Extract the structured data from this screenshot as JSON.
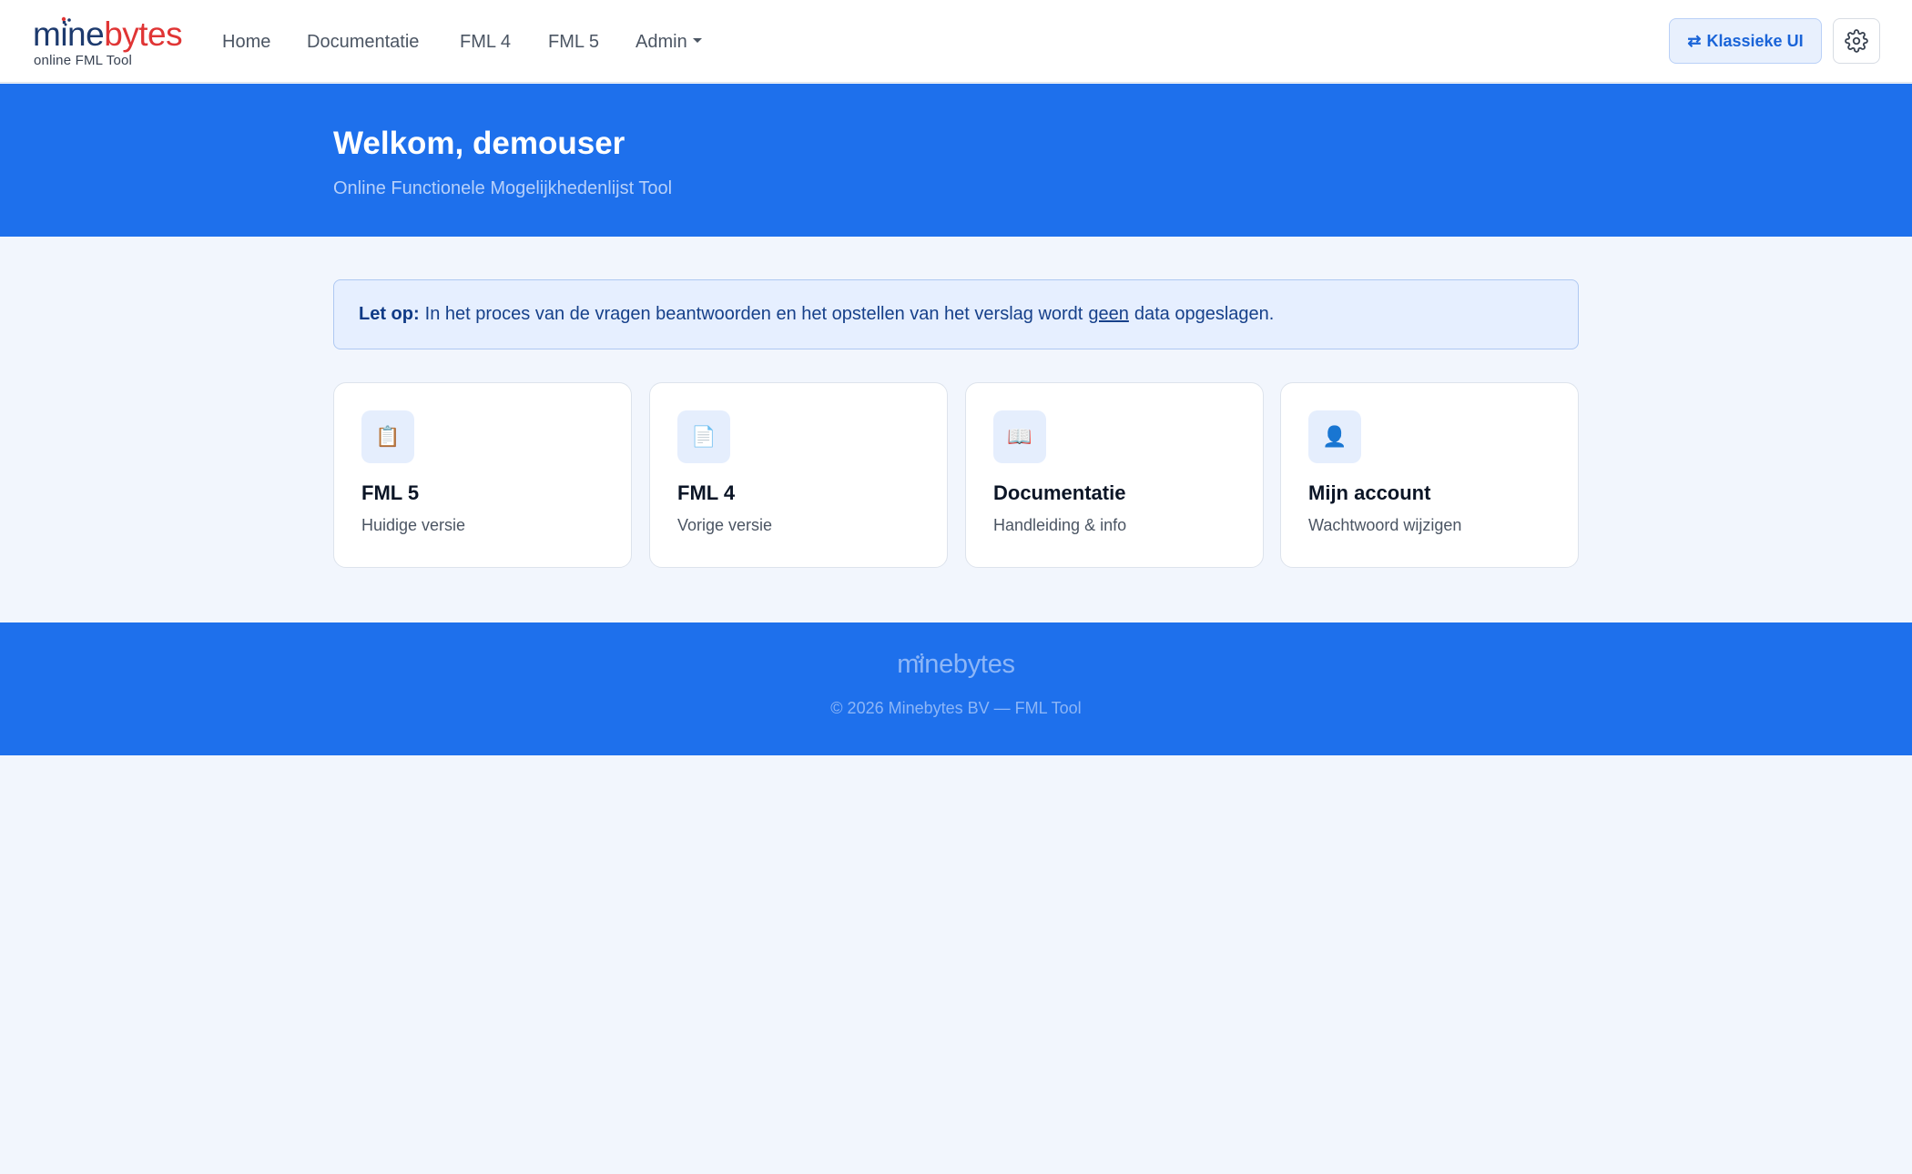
{
  "brand": {
    "mine": "mine",
    "bytes": "bytes",
    "tagline": "online FML Tool",
    "colors": {
      "mine": "#1d3a6e",
      "bytes": "#e03535"
    }
  },
  "nav": {
    "home": "Home",
    "docs": "Documentatie",
    "fml4": "FML 4",
    "fml5": "FML 5",
    "admin": "Admin"
  },
  "actions": {
    "classic_icon": "⇄",
    "classic_label": "Klassieke UI",
    "settings_icon": "gear-icon"
  },
  "hero": {
    "title": "Welkom, demouser",
    "subtitle": "Online Functionele Mogelijkhedenlijst Tool"
  },
  "notice": {
    "label": "Let op:",
    "text_before": "In het proces van de vragen beantwoorden en het opstellen van het verslag wordt",
    "emphasis": "geen",
    "text_after": "data opgeslagen."
  },
  "cards": [
    {
      "icon": "📋",
      "icon_name": "clipboard-icon",
      "title": "FML 5",
      "subtitle": "Huidige versie"
    },
    {
      "icon": "📄",
      "icon_name": "document-icon",
      "title": "FML 4",
      "subtitle": "Vorige versie"
    },
    {
      "icon": "📖",
      "icon_name": "open-book-icon",
      "title": "Documentatie",
      "subtitle": "Handleiding & info"
    },
    {
      "icon": "👤",
      "icon_name": "user-icon",
      "title": "Mijn account",
      "subtitle": "Wachtwoord wijzigen"
    }
  ],
  "footer": {
    "logo": "minebytes",
    "copyright": "© 2026 Minebytes BV — FML Tool"
  },
  "colors": {
    "primary": "#1e70ec",
    "page_background": "#f2f6fd",
    "notice_background": "#e6efff"
  }
}
